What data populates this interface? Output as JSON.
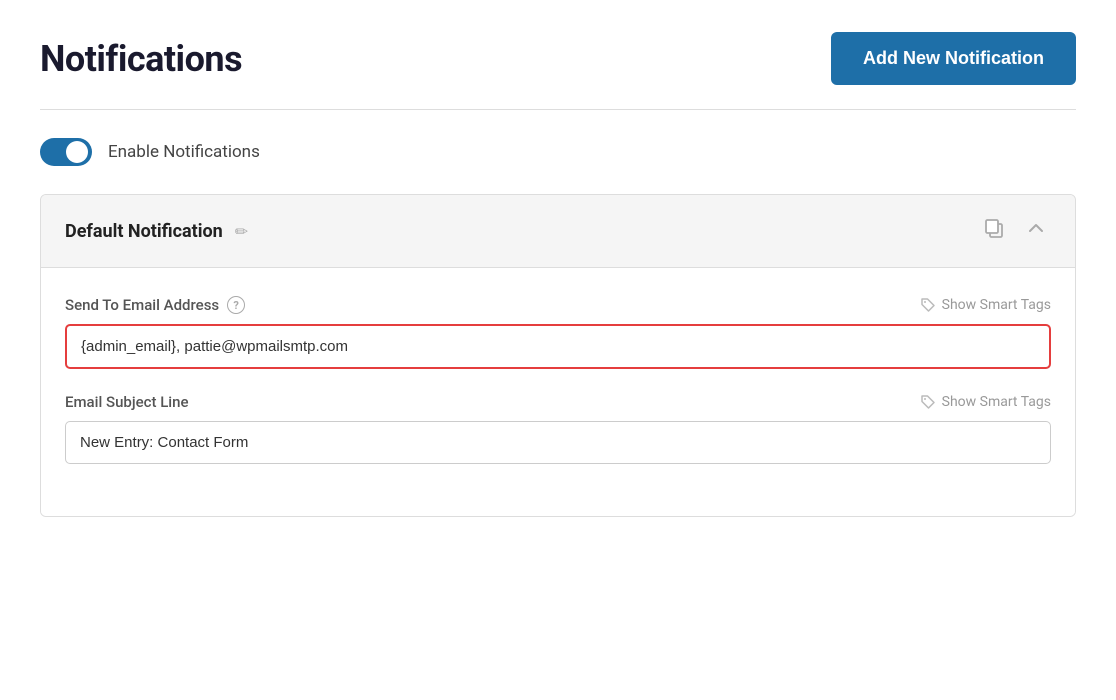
{
  "page": {
    "title": "Notifications",
    "add_button_label": "Add New Notification"
  },
  "toggle": {
    "label": "Enable Notifications",
    "enabled": true
  },
  "notification_card": {
    "title": "Default Notification",
    "edit_icon": "✏",
    "duplicate_icon": "⧉",
    "collapse_icon": "▲",
    "fields": [
      {
        "id": "send_to_email",
        "label": "Send To Email Address",
        "has_help": true,
        "show_smart_tags_label": "Show Smart Tags",
        "value": "{admin_email}, pattie@wpmailsmtp.com",
        "placeholder": "",
        "has_error": true
      },
      {
        "id": "email_subject",
        "label": "Email Subject Line",
        "has_help": false,
        "show_smart_tags_label": "Show Smart Tags",
        "value": "New Entry: Contact Form",
        "placeholder": "",
        "has_error": false
      }
    ]
  }
}
